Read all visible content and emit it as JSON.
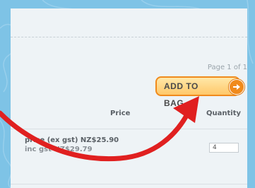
{
  "pagination": {
    "text": "Page 1 of 1"
  },
  "add_to_bag": {
    "label": "ADD TO BAG"
  },
  "table": {
    "headers": {
      "price": "Price",
      "quantity": "Quantity"
    },
    "item": {
      "price_ex_gst": "price (ex gst)  NZ$25.90",
      "price_inc_gst": "inc gst  NZ$29.79",
      "quantity": "4"
    }
  },
  "colors": {
    "background": "#7ec3e6",
    "panel": "#eef3f6",
    "button_border": "#f08a1c",
    "arrow": "#e02020"
  },
  "icons": {
    "button_arrow": "arrow-right-circle-icon",
    "annotation": "curved-red-arrow"
  }
}
